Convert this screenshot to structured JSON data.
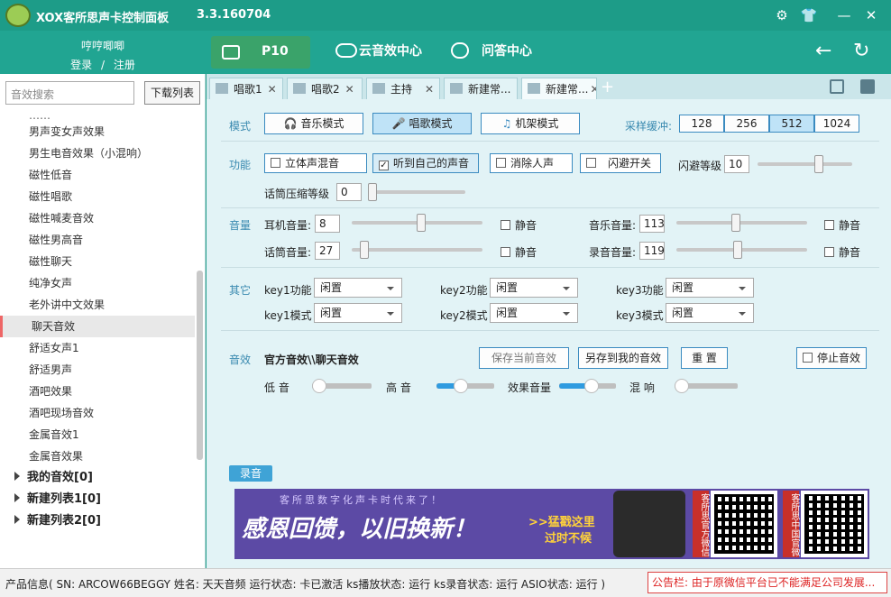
{
  "app": {
    "title": "XOX客所思声卡控制面板",
    "version": "3.3.160704"
  },
  "user": {
    "name": "哼哼唧唧",
    "login": "登录",
    "sep": "/",
    "register": "注册"
  },
  "header": {
    "device": "P10",
    "cloud": "云音效中心",
    "qa": "问答中心"
  },
  "left": {
    "search_placeholder": "音效搜索",
    "download": "下载列表",
    "items": [
      "男声变女声效果",
      "男生电音效果（小混响）",
      "磁性低音",
      "磁性唱歌",
      "磁性喊麦音效",
      "磁性男高音",
      "磁性聊天",
      "纯净女声",
      "老外讲中文效果",
      "聊天音效",
      "舒适女声1",
      "舒适男声",
      "酒吧效果",
      "酒吧现场音效",
      "金属音效1",
      "金属音效果"
    ],
    "groups": [
      "我的音效[0]",
      "新建列表1[0]",
      "新建列表2[0]"
    ]
  },
  "tabs": [
    "唱歌1",
    "唱歌2",
    "主持",
    "新建常...",
    "新建常..."
  ],
  "mode": {
    "label": "模式",
    "music": "音乐模式",
    "sing": "唱歌模式",
    "mech": "机架模式",
    "buffer_label": "采样缓冲:",
    "buffers": [
      "128",
      "256",
      "512",
      "1024"
    ],
    "buffer_selected": "512"
  },
  "func": {
    "label": "功能",
    "stereo": "立体声混音",
    "hear": "听到自己的声音",
    "hear_checked": true,
    "remove": "消除人声",
    "flash": "闪避开关",
    "flash_level_label": "闪避等级",
    "flash_level": "10",
    "flash_level_value": 0.66,
    "mic_comp_label": "话筒压缩等级",
    "mic_comp": "0",
    "mic_comp_value": 0.0
  },
  "volume": {
    "label": "音量",
    "headphone_label": "耳机音量:",
    "headphone": "8",
    "headphone_value": 0.53,
    "music_label": "音乐音量:",
    "music": "113",
    "music_value": 0.45,
    "mic_label": "话筒音量:",
    "mic": "27",
    "mic_value": 0.07,
    "record_label": "录音音量:",
    "record": "119",
    "record_value": 0.47,
    "mute": "静音"
  },
  "other": {
    "label": "其它",
    "k1f": "key1功能",
    "k2f": "key2功能",
    "k3f": "key3功能",
    "k1m": "key1模式",
    "k2m": "key2模式",
    "k3m": "key3模式",
    "value": "闲置"
  },
  "effect": {
    "label": "音效",
    "path": "官方音效\\\\聊天音效",
    "save_cur": "保存当前音效",
    "save_mine": "另存到我的音效",
    "reset": "重 置",
    "stop": "停止音效",
    "bass": "低 音",
    "treble": "高 音",
    "effect_vol": "效果音量",
    "reverb": "混 响",
    "bass_value": 0.0,
    "treble_value": 0.4,
    "effect_vol_value": 0.6,
    "reverb_value": 0.0
  },
  "record": "录音",
  "banner": {
    "top": "客所思数字化声卡时代来了！",
    "main": "感恩回馈，以旧换新！",
    "arrow": ">>猛戳这里",
    "sub": "过时不候",
    "qr1": "客所思官方微信",
    "qr2": "客所思中国官微"
  },
  "status": {
    "text": "产品信息( SN: ARCOW66BEGGY  姓名: 天天音频  运行状态: 卡已激活  ks播放状态: 运行  ks录音状态: 运行  ASIO状态: 运行 )",
    "notice": "公告栏: 由于原微信平台已不能满足公司发展..."
  },
  "colors": {
    "titlebar": "#1d9c88",
    "accent": "#3b8bc0",
    "section": "#3a8ab0"
  }
}
